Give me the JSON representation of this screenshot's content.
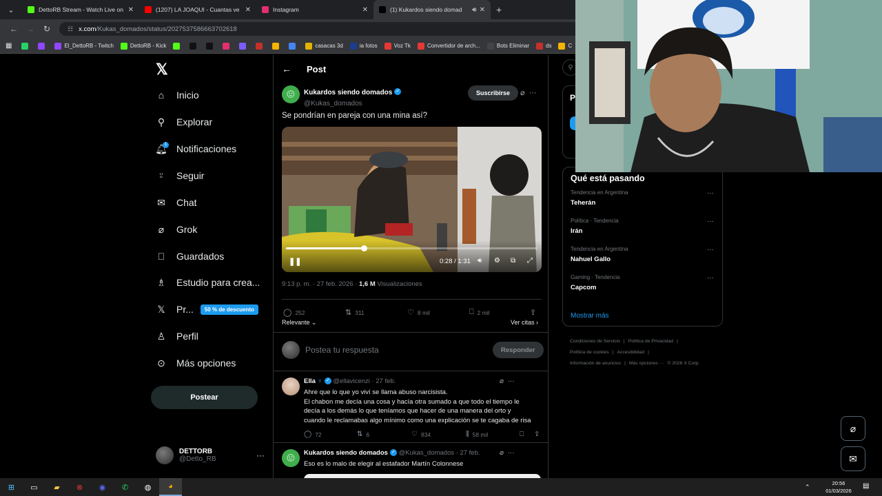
{
  "browser": {
    "tabs": [
      {
        "title": "DettoRB Stream - Watch Live on",
        "color": "#53fc18",
        "active": false
      },
      {
        "title": "(1207) LA JOAQUI - Cuantas ve",
        "color": "#ff0000",
        "active": false
      },
      {
        "title": "Instagram",
        "color": "#e1306c",
        "active": false
      },
      {
        "title": "(1) Kukardos siendo domad",
        "color": "#000000",
        "active": true
      }
    ],
    "url_domain": "x.com",
    "url_path": "/Kukas_domados/status/2027537586663702618",
    "bookmarks": [
      {
        "label": "",
        "color": "#25d366"
      },
      {
        "label": "",
        "color": "#9146ff"
      },
      {
        "label": "El_DettoRB - Twitch",
        "color": "#9146ff"
      },
      {
        "label": "DettoRB - Kick",
        "color": "#53fc18"
      },
      {
        "label": "",
        "color": "#53fc18"
      },
      {
        "label": "",
        "color": "#111111"
      },
      {
        "label": "",
        "color": "#111111"
      },
      {
        "label": "",
        "color": "#e1306c"
      },
      {
        "label": "",
        "color": "#7b5cff"
      },
      {
        "label": "",
        "color": "#c4302b"
      },
      {
        "label": "",
        "color": "#f4b400"
      },
      {
        "label": "",
        "color": "#4285f4"
      },
      {
        "label": "casacas 3d",
        "color": "#e2b400"
      },
      {
        "label": "ia fotos",
        "color": "#1a3d8f"
      },
      {
        "label": "Voz Tk",
        "color": "#e53935"
      },
      {
        "label": "Convertidor de arch...",
        "color": "#e53935"
      },
      {
        "label": "Bots Eliminar",
        "color": "#444444"
      },
      {
        "label": "ds",
        "color": "#c4302b"
      },
      {
        "label": "C",
        "color": "#f4b400"
      }
    ]
  },
  "sidebar": {
    "items": [
      {
        "label": "Inicio",
        "icon": "home-icon",
        "glyph": "⌂"
      },
      {
        "label": "Explorar",
        "icon": "search-icon",
        "glyph": "⚲"
      },
      {
        "label": "Notificaciones",
        "icon": "bell-icon",
        "glyph": "🔔︎"
      },
      {
        "label": "Seguir",
        "icon": "follow-icon",
        "glyph": "⍤"
      },
      {
        "label": "Chat",
        "icon": "mail-icon",
        "glyph": "✉"
      },
      {
        "label": "Grok",
        "icon": "grok-icon",
        "glyph": "⌀"
      },
      {
        "label": "Guardados",
        "icon": "bookmark-icon",
        "glyph": "⎕"
      },
      {
        "label": "Estudio para crea...",
        "icon": "studio-icon",
        "glyph": "♗"
      },
      {
        "label": "Pr...",
        "icon": "premium-x-icon",
        "glyph": "𝕏"
      },
      {
        "label": "Perfil",
        "icon": "profile-icon",
        "glyph": "♙"
      },
      {
        "label": "Más opciones",
        "icon": "more-options-icon",
        "glyph": "⊙"
      }
    ],
    "notif_count": "1",
    "promo": "50 % de descuento",
    "post_button": "Postear",
    "account_name": "DETTORB",
    "account_handle": "@Detto_RB"
  },
  "post": {
    "header": "Post",
    "author_name": "Kukardos siendo domados",
    "author_handle": "@Kukas_domados",
    "subscribe": "Suscribirse",
    "text": "Se pondrían en pareja con una mina así?",
    "video_time": "0:28 / 1:31",
    "video_progress": 0.31,
    "meta_time": "9:13 p. m. · 27 feb. 2026 · ",
    "views": "1,6 M",
    "views_label": " Visualizaciones",
    "replies": "252",
    "reposts": "311",
    "likes": "8 mil",
    "bookmarks": "2 mil",
    "sort": "Relevante",
    "quotes": "Ver citas",
    "reply_placeholder": "Postea tu respuesta",
    "reply_button": "Responder"
  },
  "replies": [
    {
      "name": "Ella",
      "handle": "@ellavicenzi",
      "date": "· 27 feb.",
      "lines": [
        "Ahre que lo que yo viví se llama abuso narcisista.",
        "El chabon me decía una cosa y hacía otra sumado a que todo el tiempo le",
        "decía a los demás lo que teníamos que hacer de una manera del orto y",
        "cuando le reclamabas algo mínimo como una explicación se te cagaba de risa"
      ],
      "replies": "72",
      "reposts": "6",
      "likes": "834",
      "views": "58 mil"
    },
    {
      "name": "Kukardos siendo domados",
      "handle": "@Kukas_domados",
      "date": "· 27 feb.",
      "lines": [
        "Eso es lo malo de elegir al estafador Martín Colonnese"
      ]
    }
  ],
  "right": {
    "premium_letter": "P",
    "trends_title": "Qué está pasando",
    "trends": [
      {
        "context": "Tendencia en Argentina",
        "name": "Teherán"
      },
      {
        "context": "Política · Tendencia",
        "name": "Irán"
      },
      {
        "context": "Tendencia en Argentina",
        "name": "Nahuel Gallo"
      },
      {
        "context": "Gaming · Tendencia",
        "name": "Capcom"
      }
    ],
    "show_more": "Mostrar más",
    "footer": [
      "Condiciones de Servicio",
      "|",
      "Política de Privacidad",
      "|",
      "Política de cookies",
      "|",
      "Accesibilidad",
      "|",
      "Información de anuncios",
      "|",
      "Más opciones ···",
      "© 2026 X Corp."
    ]
  },
  "taskbar": {
    "time": "20:56",
    "date": "01/03/2026"
  }
}
